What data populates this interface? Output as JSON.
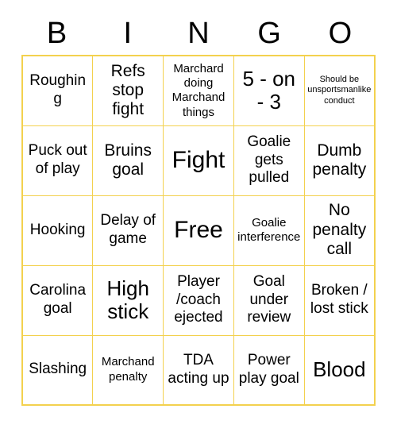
{
  "header": {
    "letters": [
      "B",
      "I",
      "N",
      "G",
      "O"
    ]
  },
  "colors": {
    "grid_border": "#f3d14e",
    "text": "#000000",
    "background": "#ffffff"
  },
  "grid": {
    "columns": 5,
    "rows": 5,
    "cells": [
      [
        {
          "text": "Roughing",
          "size": "md"
        },
        {
          "text": "Refs stop fight",
          "size": "lg"
        },
        {
          "text": "Marchard doing Marchand things",
          "size": "sm"
        },
        {
          "text": "5 - on - 3",
          "size": "xl"
        },
        {
          "text": "Should be unsportsmanlike conduct",
          "size": "xs"
        }
      ],
      [
        {
          "text": "Puck out of play",
          "size": "md"
        },
        {
          "text": "Bruins goal",
          "size": "lg"
        },
        {
          "text": "Fight",
          "size": "xxl"
        },
        {
          "text": "Goalie gets pulled",
          "size": "md"
        },
        {
          "text": "Dumb penalty",
          "size": "lg"
        }
      ],
      [
        {
          "text": "Hooking",
          "size": "md"
        },
        {
          "text": "Delay of game",
          "size": "md"
        },
        {
          "text": "Free",
          "size": "xxl"
        },
        {
          "text": "Goalie interference",
          "size": "sm"
        },
        {
          "text": "No penalty call",
          "size": "lg"
        }
      ],
      [
        {
          "text": "Carolina goal",
          "size": "md"
        },
        {
          "text": "High stick",
          "size": "xl"
        },
        {
          "text": "Player /coach ejected",
          "size": "md"
        },
        {
          "text": "Goal under review",
          "size": "md"
        },
        {
          "text": "Broken / lost stick",
          "size": "md"
        }
      ],
      [
        {
          "text": "Slashing",
          "size": "md"
        },
        {
          "text": "Marchand penalty",
          "size": "sm"
        },
        {
          "text": "TDA acting up",
          "size": "md"
        },
        {
          "text": "Power play goal",
          "size": "md"
        },
        {
          "text": "Blood",
          "size": "xl"
        }
      ]
    ]
  }
}
